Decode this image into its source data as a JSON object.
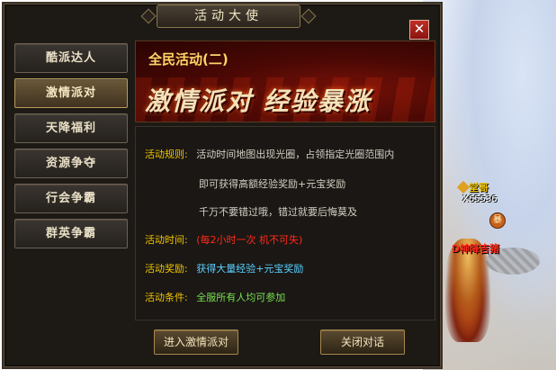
{
  "window": {
    "title": "活动大使",
    "close_glyph": "✕"
  },
  "nav": {
    "items": [
      {
        "label": "酷派达人"
      },
      {
        "label": "激情派对"
      },
      {
        "label": "天降福利"
      },
      {
        "label": "资源争夺"
      },
      {
        "label": "行会争霸"
      },
      {
        "label": "群英争霸"
      }
    ],
    "active_index": 1
  },
  "banner": {
    "subtitle": "全民活动(二)",
    "headline": "激情派对 经验暴涨"
  },
  "content": {
    "rules_label": "活动规则:",
    "rules_lines": [
      "活动时间地图出现光圈，占领指定光圈范围内",
      "即可获得高额经验奖励+元宝奖励",
      "千万不要错过哦，错过就要后悔莫及"
    ],
    "time_label": "活动时间:",
    "time_value": "(每2小时一次  机不可失)",
    "reward_label": "活动奖励:",
    "reward_value": "获得大量经验+元宝奖励",
    "condition_label": "活动条件:",
    "condition_value": "全服所有人均可参加"
  },
  "buttons": {
    "enter": "进入激情派对",
    "close": "关闭对话"
  },
  "scene": {
    "player_name": "堂哥",
    "player_id": "X65536",
    "badge": "暴",
    "red_name": "D神降吉猪"
  },
  "colors": {
    "label_yellow": "#f0c400",
    "time_red": "#ff2a1a",
    "reward_cyan": "#5cd0ff",
    "condition_green": "#78e050"
  }
}
